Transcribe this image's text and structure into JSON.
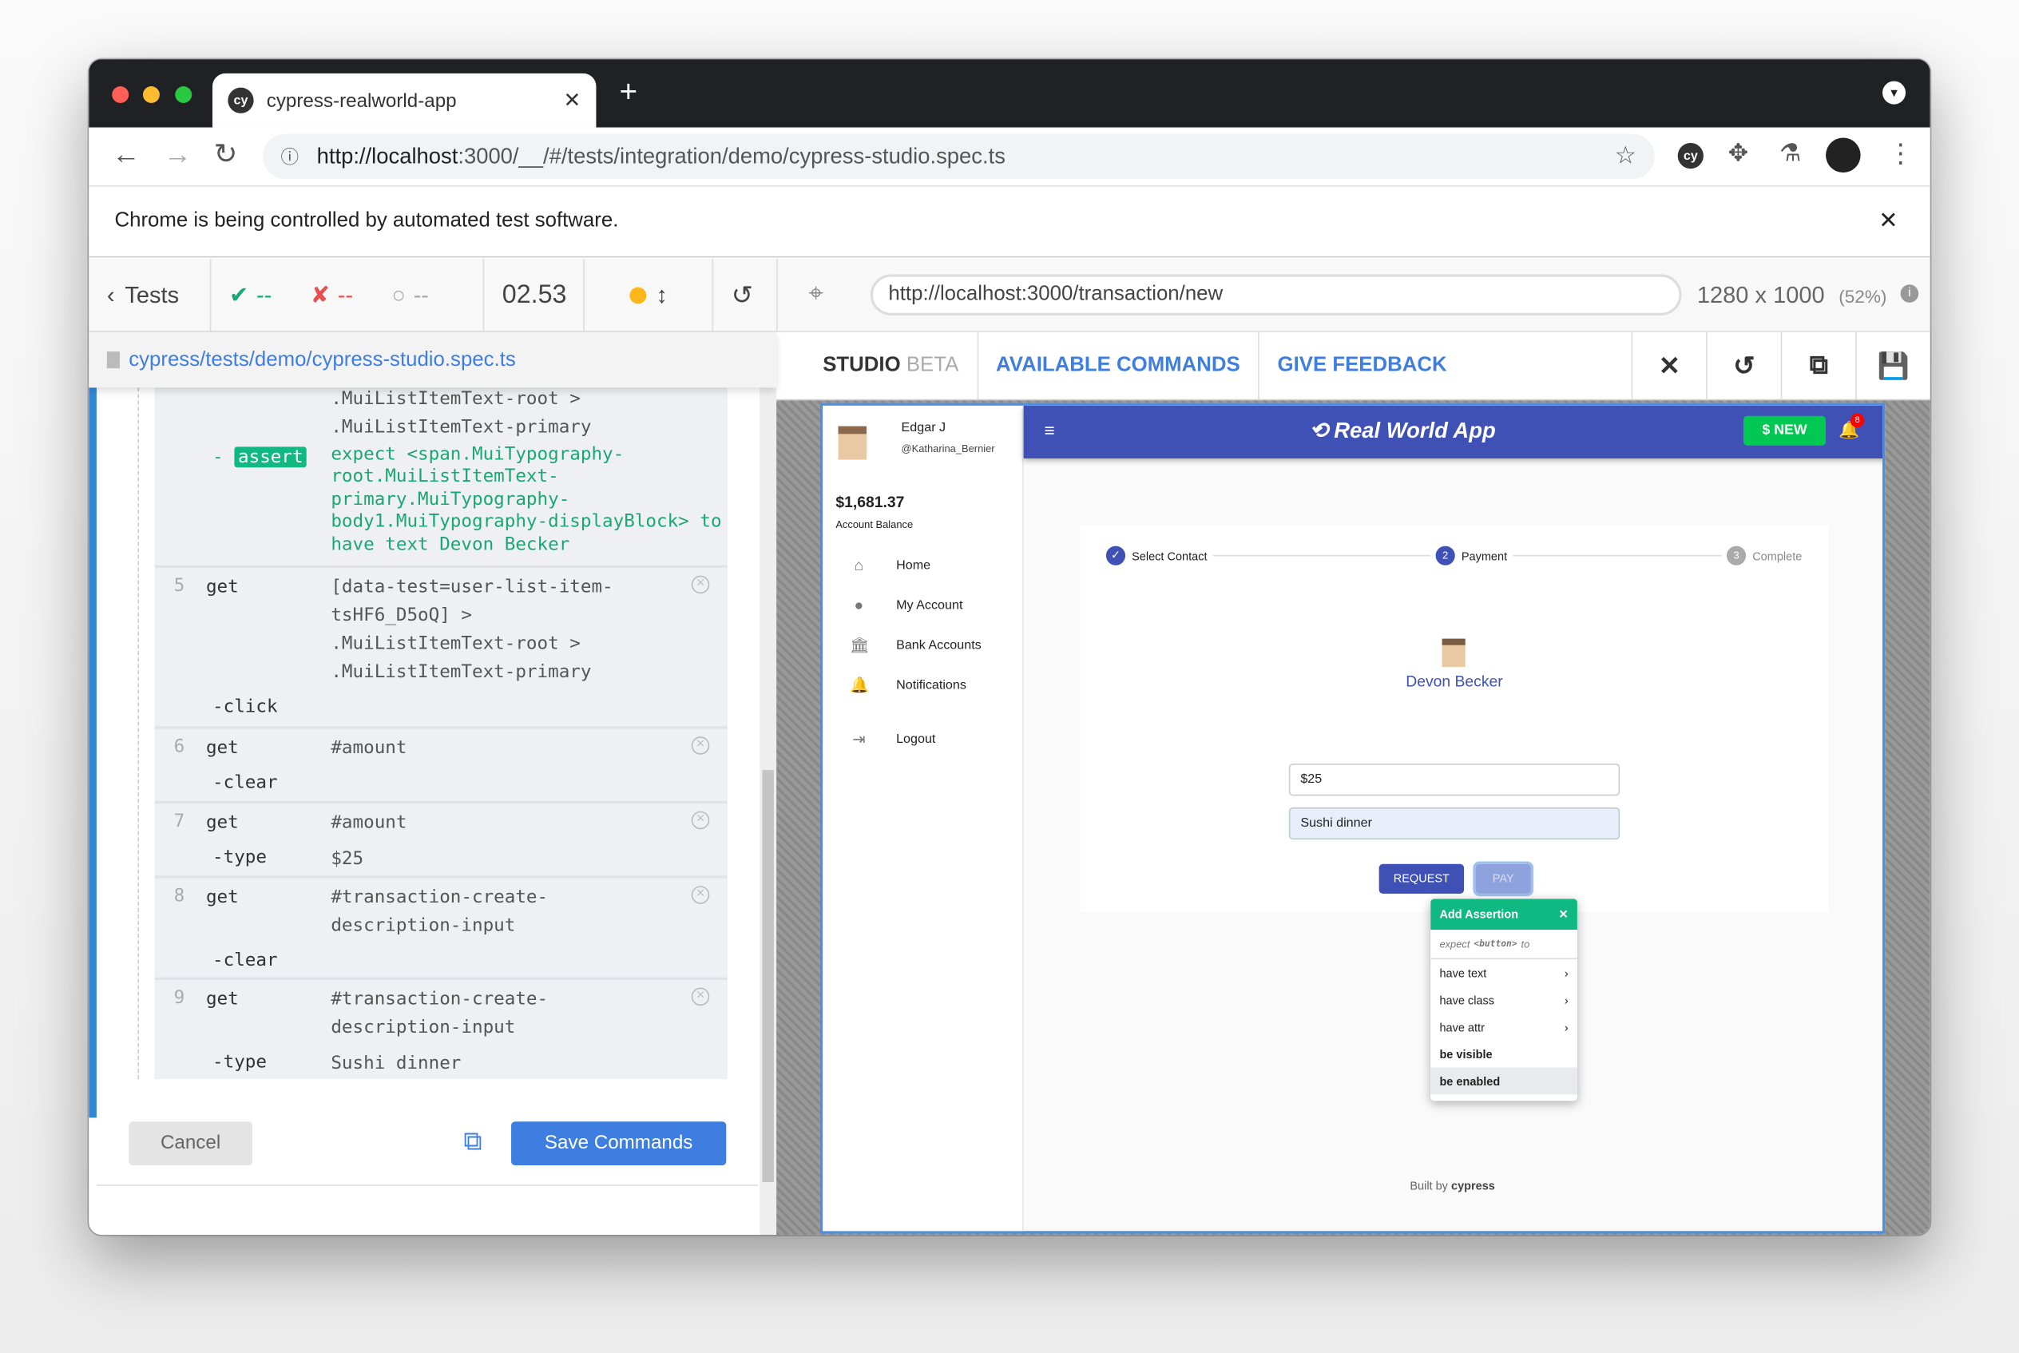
{
  "browser": {
    "tab_title": "cypress-realworld-app",
    "url_host": "http://localhost",
    "url_rest": ":3000/__/#/tests/integration/demo/cypress-studio.spec.ts",
    "infobar": "Chrome is being controlled by automated test software."
  },
  "runner": {
    "tests_label": "Tests",
    "passed": "--",
    "failed": "--",
    "pending": "--",
    "duration": "02.53",
    "aut_url": "http://localhost:3000/transaction/new",
    "viewport": "1280 x 1000",
    "scale": "(52%)",
    "spec_path": "cypress/tests/demo/cypress-studio.spec.ts"
  },
  "commands": {
    "prev_lines": [
      ".MuiListItemText-root >",
      ".MuiListItemText-primary"
    ],
    "assert_label": "assert",
    "assert_lines": [
      "expect <span.MuiTypography-",
      "root.MuiListItemText-",
      "primary.MuiTypography-",
      "body1.MuiTypography-displayBlock> to",
      "have text  Devon Becker"
    ],
    "items": [
      {
        "num": "5",
        "cmd": "get",
        "arg": [
          "[data-test=user-list-item-",
          "tsHF6_D5oQ] >",
          ".MuiListItemText-root >",
          ".MuiListItemText-primary"
        ],
        "sub": "-click",
        "subarg": ""
      },
      {
        "num": "6",
        "cmd": "get",
        "arg": [
          "#amount"
        ],
        "sub": "-clear",
        "subarg": ""
      },
      {
        "num": "7",
        "cmd": "get",
        "arg": [
          "#amount"
        ],
        "sub": "-type",
        "subarg": "$25"
      },
      {
        "num": "8",
        "cmd": "get",
        "arg": [
          "#transaction-create-",
          "description-input"
        ],
        "sub": "-clear",
        "subarg": ""
      },
      {
        "num": "9",
        "cmd": "get",
        "arg": [
          "#transaction-create-",
          "description-input"
        ],
        "sub": "-type",
        "subarg": "Sushi dinner"
      }
    ],
    "cancel": "Cancel",
    "save": "Save Commands"
  },
  "studio": {
    "title": "STUDIO",
    "beta": "BETA",
    "available": "AVAILABLE COMMANDS",
    "feedback": "GIVE FEEDBACK"
  },
  "app": {
    "user_name": "Edgar J",
    "username": "@Katharina_Bernier",
    "balance": "$1,681.37",
    "balance_label": "Account Balance",
    "nav": [
      "Home",
      "My Account",
      "Bank Accounts",
      "Notifications",
      "Logout"
    ],
    "title": "Real World App",
    "new_btn": "$ NEW",
    "notif_count": "8",
    "steps": [
      "Select Contact",
      "Payment",
      "Complete"
    ],
    "step_nums": [
      "2",
      "3"
    ],
    "contact": "Devon Becker",
    "amount": "$25",
    "note": "Sushi dinner",
    "request": "REQUEST",
    "pay": "PAY",
    "built_by": "Built by",
    "brand": "cypress"
  },
  "assertion": {
    "title": "Add Assertion",
    "expect": "expect",
    "el": "<button>",
    "to": "to",
    "options": [
      "have text",
      "have class",
      "have attr",
      "be visible",
      "be enabled"
    ]
  },
  "colors": {
    "accent": "#3f51b5",
    "green": "#0fb981",
    "link": "#3e7ee0"
  }
}
